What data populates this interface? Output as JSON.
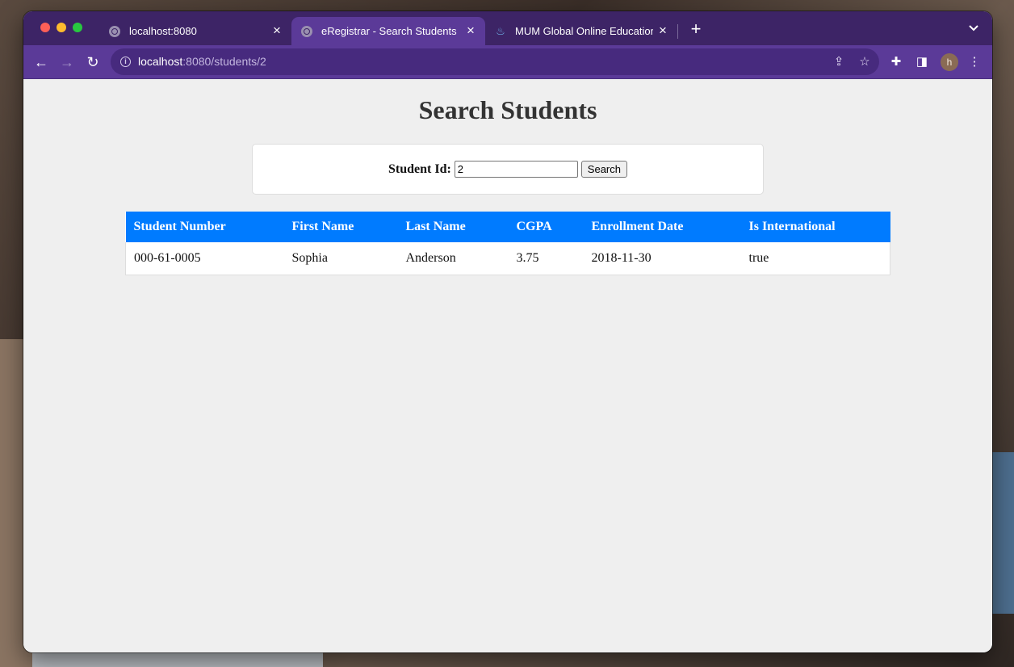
{
  "tabs": [
    {
      "title": "localhost:8080",
      "icon": "globe-icon",
      "active": false
    },
    {
      "title": "eRegistrar - Search Students",
      "icon": "globe-icon",
      "active": true
    },
    {
      "title": "MUM Global Online Education",
      "icon": "java-icon",
      "active": false
    }
  ],
  "address_bar": {
    "host": "localhost",
    "path": ":8080/students/2"
  },
  "page": {
    "title": "Search Students",
    "search": {
      "label": "Student Id:",
      "value": "2",
      "button_label": "Search"
    }
  },
  "table": {
    "headers": [
      "Student Number",
      "First Name",
      "Last Name",
      "CGPA",
      "Enrollment Date",
      "Is International"
    ],
    "rows": [
      [
        "000-61-0005",
        "Sophia",
        "Anderson",
        "3.75",
        "2018-11-30",
        "true"
      ]
    ]
  },
  "profile": {
    "initial": "h"
  },
  "colors": {
    "browser_frame": "#3d2466",
    "toolbar": "#5b3a98",
    "table_header": "#007bff"
  }
}
